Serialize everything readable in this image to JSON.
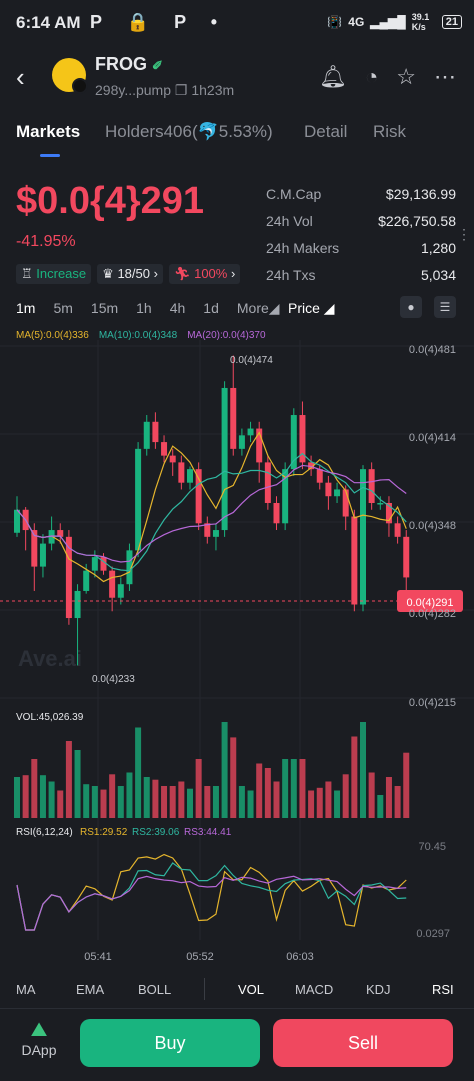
{
  "status_bar": {
    "time": "6:14 AM",
    "left_icons": "P 🔒 P •",
    "net_speed": "39.1 K/s",
    "signal": "4G",
    "battery": "21"
  },
  "header": {
    "token_name": "FROG",
    "address": "298y...pump",
    "age": "1h23m"
  },
  "tabs": [
    {
      "label": "Markets",
      "active": true
    },
    {
      "label": "Holders406(🐬5.53%)",
      "active": false
    },
    {
      "label": "Detail",
      "active": false
    },
    {
      "label": "Risk",
      "active": false
    }
  ],
  "price": {
    "value": "$0.0{4}291",
    "change": "-41.95%"
  },
  "badges": [
    {
      "icon": "trophy-icon",
      "label": "Increase",
      "color": "#19b47f"
    },
    {
      "icon": "crown-icon",
      "label": "18/50",
      "color": "#e8e9ec"
    },
    {
      "icon": "runner-icon",
      "label": "100%",
      "color": "#f2485f"
    }
  ],
  "stats": [
    {
      "label": "C.M.Cap",
      "value": "$29,136.99"
    },
    {
      "label": "24h Vol",
      "value": "$226,750.58"
    },
    {
      "label": "24h Makers",
      "value": "1,280"
    },
    {
      "label": "24h Txs",
      "value": "5,034"
    }
  ],
  "intervals": [
    "1m",
    "5m",
    "15m",
    "1h",
    "4h",
    "1d",
    "More"
  ],
  "active_interval": "1m",
  "price_selector": "Price",
  "ma_legend": [
    {
      "label": "MA(5):0.0(4)336",
      "color": "#e5b52d"
    },
    {
      "label": "MA(10):0.0(4)348",
      "color": "#2fb6a0"
    },
    {
      "label": "MA(20):0.0(4)370",
      "color": "#b768d8"
    }
  ],
  "chart_data": {
    "type": "candlestick",
    "y_axis_labels": [
      "0.0(4)481",
      "0.0(4)414",
      "0.0(4)348",
      "0.0(4)282",
      "0.0(4)215"
    ],
    "current_price_label": "0.0(4)291",
    "high_label": "0.0(4)474",
    "low_label": "0.0(4)233",
    "watermark": "Ave.ai",
    "time_labels": [
      "05:41",
      "05:52",
      "06:03"
    ],
    "colors": {
      "up": "#19b47f",
      "down": "#f2485f"
    },
    "candles": [
      {
        "o": 343,
        "c": 360,
        "h": 370,
        "l": 340
      },
      {
        "o": 360,
        "c": 345,
        "h": 362,
        "l": 330
      },
      {
        "o": 345,
        "c": 318,
        "h": 350,
        "l": 300
      },
      {
        "o": 318,
        "c": 335,
        "h": 342,
        "l": 310
      },
      {
        "o": 335,
        "c": 345,
        "h": 355,
        "l": 330
      },
      {
        "o": 345,
        "c": 340,
        "h": 350,
        "l": 335
      },
      {
        "o": 340,
        "c": 280,
        "h": 345,
        "l": 275
      },
      {
        "o": 280,
        "c": 300,
        "h": 305,
        "l": 245
      },
      {
        "o": 300,
        "c": 315,
        "h": 320,
        "l": 298
      },
      {
        "o": 315,
        "c": 325,
        "h": 330,
        "l": 310
      },
      {
        "o": 325,
        "c": 315,
        "h": 328,
        "l": 312
      },
      {
        "o": 315,
        "c": 295,
        "h": 318,
        "l": 285
      },
      {
        "o": 295,
        "c": 305,
        "h": 310,
        "l": 290
      },
      {
        "o": 305,
        "c": 330,
        "h": 335,
        "l": 300
      },
      {
        "o": 330,
        "c": 405,
        "h": 410,
        "l": 325
      },
      {
        "o": 405,
        "c": 425,
        "h": 430,
        "l": 400
      },
      {
        "o": 425,
        "c": 410,
        "h": 432,
        "l": 405
      },
      {
        "o": 410,
        "c": 400,
        "h": 415,
        "l": 395
      },
      {
        "o": 400,
        "c": 395,
        "h": 405,
        "l": 385
      },
      {
        "o": 395,
        "c": 380,
        "h": 400,
        "l": 375
      },
      {
        "o": 380,
        "c": 390,
        "h": 392,
        "l": 375
      },
      {
        "o": 390,
        "c": 350,
        "h": 395,
        "l": 345
      },
      {
        "o": 350,
        "c": 340,
        "h": 355,
        "l": 335
      },
      {
        "o": 340,
        "c": 345,
        "h": 350,
        "l": 330
      },
      {
        "o": 345,
        "c": 450,
        "h": 455,
        "l": 340
      },
      {
        "o": 450,
        "c": 405,
        "h": 474,
        "l": 400
      },
      {
        "o": 405,
        "c": 415,
        "h": 420,
        "l": 400
      },
      {
        "o": 415,
        "c": 420,
        "h": 425,
        "l": 410
      },
      {
        "o": 420,
        "c": 395,
        "h": 425,
        "l": 380
      },
      {
        "o": 395,
        "c": 365,
        "h": 400,
        "l": 360
      },
      {
        "o": 365,
        "c": 350,
        "h": 370,
        "l": 345
      },
      {
        "o": 350,
        "c": 390,
        "h": 395,
        "l": 345
      },
      {
        "o": 390,
        "c": 430,
        "h": 435,
        "l": 385
      },
      {
        "o": 430,
        "c": 395,
        "h": 440,
        "l": 390
      },
      {
        "o": 395,
        "c": 390,
        "h": 400,
        "l": 385
      },
      {
        "o": 390,
        "c": 380,
        "h": 393,
        "l": 375
      },
      {
        "o": 380,
        "c": 370,
        "h": 385,
        "l": 360
      },
      {
        "o": 370,
        "c": 375,
        "h": 380,
        "l": 365
      },
      {
        "o": 375,
        "c": 355,
        "h": 378,
        "l": 345
      },
      {
        "o": 355,
        "c": 290,
        "h": 360,
        "l": 285
      },
      {
        "o": 290,
        "c": 390,
        "h": 393,
        "l": 285
      },
      {
        "o": 390,
        "c": 365,
        "h": 395,
        "l": 360
      },
      {
        "o": 365,
        "c": 365,
        "h": 370,
        "l": 360
      },
      {
        "o": 365,
        "c": 350,
        "h": 370,
        "l": 340
      },
      {
        "o": 350,
        "c": 340,
        "h": 355,
        "l": 335
      },
      {
        "o": 340,
        "c": 310,
        "h": 345,
        "l": 288
      }
    ]
  },
  "volume": {
    "label": "VOL:45,026.39"
  },
  "rsi": {
    "label": "RSI(6,12,24)",
    "rsi1": "RS1:29.52",
    "rsi2": "RS2:39.06",
    "rsi3": "RS3:44.41",
    "upper": "70.45",
    "lower": "0.0297"
  },
  "indicators": [
    "MA",
    "EMA",
    "BOLL",
    "VOL",
    "MACD",
    "KDJ",
    "RSI"
  ],
  "bottom_bar": {
    "dapp": "DApp",
    "buy": "Buy",
    "sell": "Sell"
  }
}
